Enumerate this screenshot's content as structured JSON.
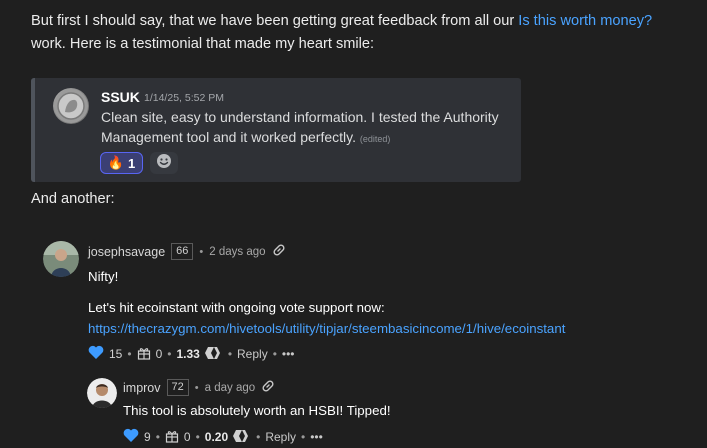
{
  "intro": {
    "before_link": "But first I should say, that we have been getting great feedback from all our ",
    "link_text": "Is this worth money?",
    "after_link": " work. Here is a testimonial that made my heart smile:"
  },
  "discord": {
    "username": "SSUK",
    "timestamp": "1/14/25, 5:52 PM",
    "message": "Clean site, easy to understand information. I tested the Authority Management tool and it worked perfectly.",
    "edited": "(edited)",
    "reaction_emoji": "🔥",
    "reaction_count": "1",
    "add_reaction_icon": "smiley-icon",
    "colors": {
      "bg": "#2f3136",
      "reaction_border": "#5865f2"
    }
  },
  "and_another": "And another:",
  "comments": [
    {
      "username": "josephsavage",
      "reputation": "66",
      "age": "2 days ago",
      "body_line1": "Nifty!",
      "body_line2": "Let's hit ecoinstant with ongoing vote support now:",
      "link": "https://thecrazygm.com/hivetools/utility/tipjar/steembasicincome/1/hive/ecoinstant",
      "votes": "15",
      "gifts": "0",
      "payout": "1.33",
      "reply_label": "Reply",
      "more_label": "•••"
    },
    {
      "username": "improv",
      "reputation": "72",
      "age": "a day ago",
      "body_line1": "This tool is absolutely worth an HSBI! Tipped!",
      "votes": "9",
      "gifts": "0",
      "payout": "0.20",
      "reply_label": "Reply",
      "more_label": "•••"
    }
  ],
  "colors": {
    "link": "#4aa3ff",
    "heart": "#3d9bff",
    "background": "#1f1f1f"
  }
}
